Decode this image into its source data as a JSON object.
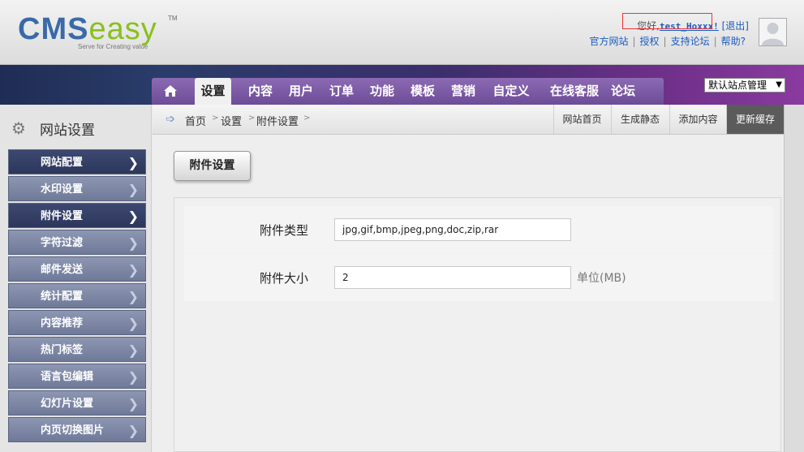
{
  "header": {
    "logo_primary": "CMS",
    "logo_secondary": "easy",
    "logo_tm": "TM",
    "logo_tagline": "Serve for Creating value",
    "greeting": "您好,",
    "username": "test_Hoxxx!",
    "logout": "[退出]",
    "links": [
      "官方网站",
      "授权",
      "支持论坛",
      "帮助?"
    ]
  },
  "nav": {
    "home_icon": "home-icon",
    "tabs": [
      "设置",
      "内容",
      "用户",
      "订单",
      "功能",
      "模板",
      "营销",
      "自定义",
      "在线客服",
      "论坛"
    ],
    "site_select": "默认站点管理"
  },
  "sidebar": {
    "title": "网站设置",
    "items": [
      "网站配置",
      "水印设置",
      "附件设置",
      "字符过滤",
      "邮件发送",
      "统计配置",
      "内容推荐",
      "热门标签",
      "语言包编辑",
      "幻灯片设置",
      "内页切换图片"
    ]
  },
  "breadcrumb": {
    "items": [
      "首页",
      "设置",
      "附件设置"
    ]
  },
  "quick_actions": [
    "网站首页",
    "生成静态",
    "添加内容",
    "更新缓存"
  ],
  "main": {
    "section_button": "附件设置",
    "fields": [
      {
        "label": "附件类型",
        "value": "jpg,gif,bmp,jpeg,png,doc,zip,rar"
      },
      {
        "label": "附件大小",
        "value": "2",
        "unit": "单位(MB)"
      }
    ]
  }
}
